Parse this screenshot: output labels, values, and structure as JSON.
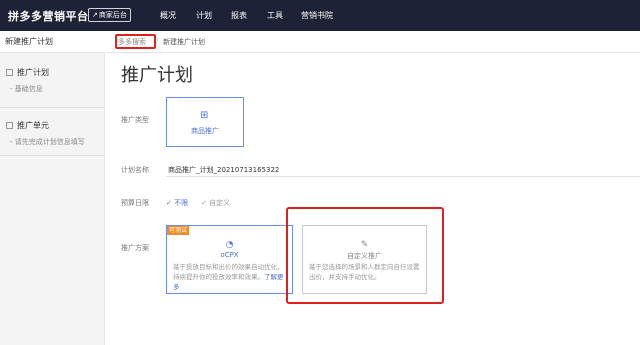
{
  "topbar": {
    "logo": "拼多多营销平台",
    "merchant_button": "商家后台",
    "nav": [
      "概况",
      "计划",
      "报表",
      "工具",
      "营销书院"
    ]
  },
  "sidebar": {
    "header": "新建推广计划",
    "section1": {
      "title": "推广计划",
      "sub": "基础信息"
    },
    "section2": {
      "title": "推广单元",
      "sub": "请先完成计划信息填写"
    }
  },
  "breadcrumb": {
    "first": "多多搜索",
    "second": "新建推广计划"
  },
  "page_title": "推广计划",
  "form": {
    "promo_type_label": "推广类型",
    "promo_type_card": "商品推广",
    "plan_name_label": "计划名称",
    "plan_name_value": "商品推广_计划_20210713165322",
    "budget_label": "预算日限",
    "budget_options": [
      "不限",
      "自定义"
    ],
    "scheme_label": "推广方案",
    "scheme_ocpx": {
      "badge": "可测试",
      "title": "oCPX",
      "desc": "基于投放目标和出价的效果自动优化，持续提升你的投放效率和效果。",
      "link": "了解更多"
    },
    "scheme_custom": {
      "title": "自定义推广",
      "desc": "基于您选择的场景和人群定向自行设置出价，并支持手动优化。"
    }
  },
  "colors": {
    "accent": "#4b6fe0",
    "highlight": "#e02020",
    "topbar": "#1e2236"
  }
}
